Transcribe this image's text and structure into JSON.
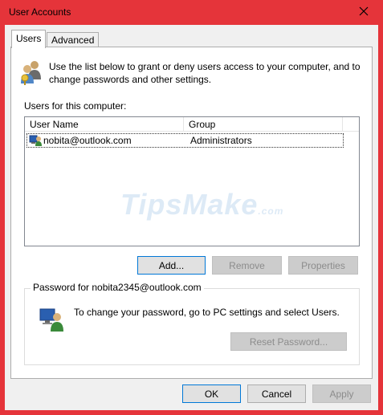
{
  "window": {
    "title": "User Accounts"
  },
  "tabs": [
    {
      "label": "Users",
      "active": true
    },
    {
      "label": "Advanced",
      "active": false
    }
  ],
  "intro_text": "Use the list below to grant or deny users access to your computer, and to change passwords and other settings.",
  "users_label": "Users for this computer:",
  "table": {
    "columns": [
      "User Name",
      "Group"
    ],
    "rows": [
      {
        "user": "nobita@outlook.com",
        "group": "Administrators"
      }
    ]
  },
  "watermark": {
    "main": "TipsMake",
    "suffix": ".com"
  },
  "list_buttons": {
    "add": "Add...",
    "remove": "Remove",
    "properties": "Properties"
  },
  "password_group": {
    "title": "Password for nobita2345@outlook.com",
    "text": "To change your password, go to PC settings and select Users.",
    "reset_button": "Reset Password..."
  },
  "dialog_buttons": {
    "ok": "OK",
    "cancel": "Cancel",
    "apply": "Apply"
  },
  "colors": {
    "frame": "#e5343a",
    "default_button_border": "#0078d7"
  },
  "icons": {
    "header": "users-icon",
    "row": "user-computer-icon",
    "password": "password-user-icon",
    "close": "close-icon"
  }
}
